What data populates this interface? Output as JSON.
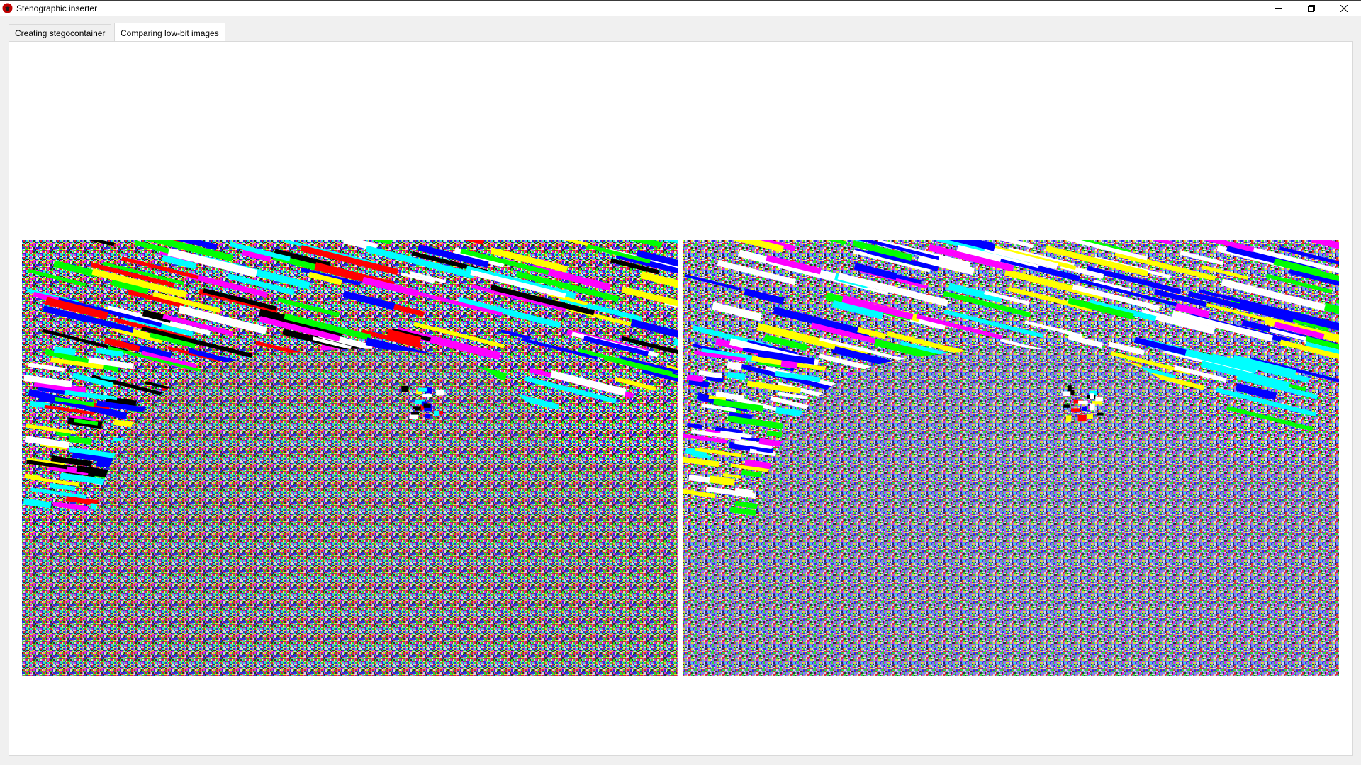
{
  "window": {
    "title": "Stenographic inserter",
    "icon": "app-logo-icon",
    "controls": [
      "minimize-icon",
      "restore-icon",
      "close-icon"
    ]
  },
  "tabs": [
    {
      "label": "Creating stegocontainer",
      "active": false
    },
    {
      "label": "Comparing low-bit images",
      "active": true
    }
  ],
  "colors": {
    "palette": [
      "#000000",
      "#ffffff",
      "#ff0000",
      "#00ff00",
      "#0000ff",
      "#ffff00",
      "#ff00ff",
      "#00ffff"
    ],
    "left_noise_bias": "neutral",
    "right_noise_bias": "blue-tinted"
  },
  "images": [
    {
      "name": "original-low-bit-image"
    },
    {
      "name": "stego-low-bit-image"
    }
  ]
}
